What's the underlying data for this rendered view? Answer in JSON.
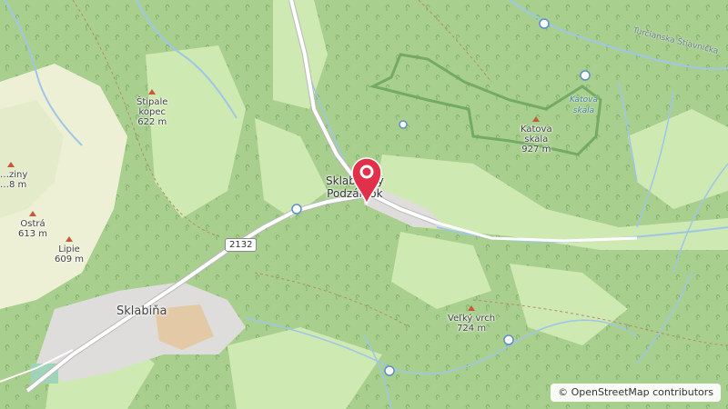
{
  "map": {
    "village_marker": {
      "label_line1": "Sklabinský",
      "label_line2": "Podzámok"
    },
    "town": {
      "name": "Sklabiňa"
    },
    "road_number": "2132",
    "river": "Turčianska Štiavnička",
    "water_label": {
      "line1": "Katova",
      "line2": "skala"
    },
    "peaks": [
      {
        "name_line1": "Štipale",
        "name_line2": "kopec",
        "elevation": "622 m"
      },
      {
        "name_line1": "Katova",
        "name_line2": "skala",
        "elevation": "927 m"
      },
      {
        "name_line1": "Ostrá",
        "name_line2": "",
        "elevation": "613 m"
      },
      {
        "name_line1": "Lipie",
        "name_line2": "",
        "elevation": "609 m"
      },
      {
        "name_line1": "Veľký vrch",
        "name_line2": "",
        "elevation": "724 m"
      },
      {
        "name_line1": "…ziny",
        "name_line2": "",
        "elevation": "…8 m"
      }
    ],
    "colors": {
      "forest": "#a9cf8f",
      "meadow": "#cfe9b3",
      "farmland": "#eef0d6",
      "residential": "#dedddb",
      "road": "#ffffff",
      "water": "#9fc6e6",
      "boundary": "#6ba35a",
      "marker": "#e0304a"
    }
  },
  "attribution": {
    "symbol": "©",
    "text": "OpenStreetMap contributors"
  }
}
